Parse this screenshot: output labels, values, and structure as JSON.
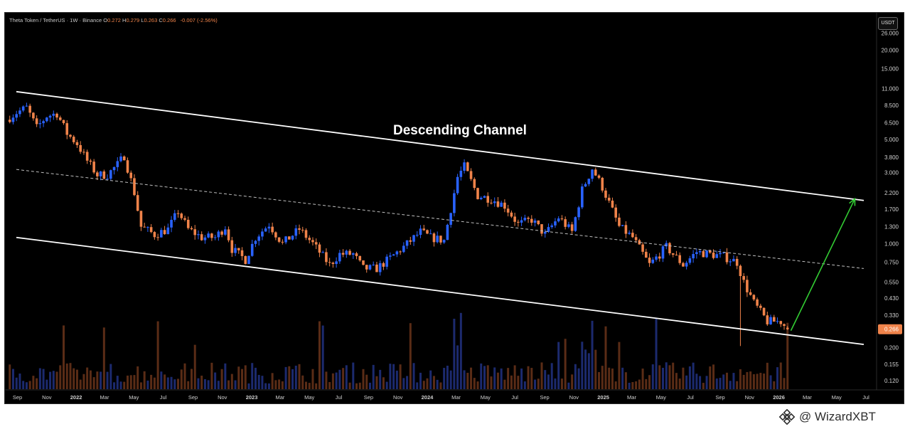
{
  "symbol_bar": {
    "title": "Theta Token / TetherUS · 1W · Binance",
    "open_label": "O",
    "open": "0.272",
    "high_label": "H",
    "high": "0.279",
    "low_label": "L",
    "low": "0.263",
    "close_label": "C",
    "close": "0.266",
    "change": "-0.007 (-2.56%)"
  },
  "currency_button": "USDT",
  "annotation": "Descending Channel",
  "watermark": {
    "icon": "binance-logo-icon",
    "text": "@ WizardXBT"
  },
  "colors": {
    "background": "#000000",
    "up": "#2962ff",
    "down": "#f0834a",
    "channel": "#ffffff",
    "arrow": "#33cc33",
    "price_tag": "#f0834a"
  },
  "chart_data": {
    "type": "candlestick",
    "scale": "log",
    "grid": false,
    "ylim": [
      0.1,
      30
    ],
    "y_ticks": [
      {
        "v": 26.0,
        "label": "26.000"
      },
      {
        "v": 20.0,
        "label": "20.000"
      },
      {
        "v": 15.0,
        "label": "15.000"
      },
      {
        "v": 11.0,
        "label": "11.000"
      },
      {
        "v": 8.5,
        "label": "8.500"
      },
      {
        "v": 6.5,
        "label": "6.500"
      },
      {
        "v": 5.0,
        "label": "5.000"
      },
      {
        "v": 3.8,
        "label": "3.800"
      },
      {
        "v": 3.0,
        "label": "3.000"
      },
      {
        "v": 2.2,
        "label": "2.200"
      },
      {
        "v": 1.7,
        "label": "1.700"
      },
      {
        "v": 1.3,
        "label": "1.300"
      },
      {
        "v": 1.0,
        "label": "1.000"
      },
      {
        "v": 0.75,
        "label": "0.750"
      },
      {
        "v": 0.55,
        "label": "0.550"
      },
      {
        "v": 0.43,
        "label": "0.430"
      },
      {
        "v": 0.33,
        "label": "0.330"
      },
      {
        "v": 0.2,
        "label": "0.200"
      },
      {
        "v": 0.155,
        "label": "0.155"
      },
      {
        "v": 0.12,
        "label": "0.120"
      }
    ],
    "current_price": {
      "value": 0.266,
      "label": "0.266"
    },
    "x_ticks": [
      {
        "date": "2021-09-01",
        "label": "Sep",
        "bold": false
      },
      {
        "date": "2021-11-01",
        "label": "Nov",
        "bold": false
      },
      {
        "date": "2022-01-01",
        "label": "2022",
        "bold": true
      },
      {
        "date": "2022-03-01",
        "label": "Mar",
        "bold": false
      },
      {
        "date": "2022-05-01",
        "label": "May",
        "bold": false
      },
      {
        "date": "2022-07-01",
        "label": "Jul",
        "bold": false
      },
      {
        "date": "2022-09-01",
        "label": "Sep",
        "bold": false
      },
      {
        "date": "2022-11-01",
        "label": "Nov",
        "bold": false
      },
      {
        "date": "2023-01-01",
        "label": "2023",
        "bold": true
      },
      {
        "date": "2023-03-01",
        "label": "Mar",
        "bold": false
      },
      {
        "date": "2023-05-01",
        "label": "May",
        "bold": false
      },
      {
        "date": "2023-07-01",
        "label": "Jul",
        "bold": false
      },
      {
        "date": "2023-09-01",
        "label": "Sep",
        "bold": false
      },
      {
        "date": "2023-11-01",
        "label": "Nov",
        "bold": false
      },
      {
        "date": "2024-01-01",
        "label": "2024",
        "bold": true
      },
      {
        "date": "2024-03-01",
        "label": "Mar",
        "bold": false
      },
      {
        "date": "2024-05-01",
        "label": "May",
        "bold": false
      },
      {
        "date": "2024-07-01",
        "label": "Jul",
        "bold": false
      },
      {
        "date": "2024-09-01",
        "label": "Sep",
        "bold": false
      },
      {
        "date": "2024-11-01",
        "label": "Nov",
        "bold": false
      },
      {
        "date": "2025-01-01",
        "label": "2025",
        "bold": true
      },
      {
        "date": "2025-03-01",
        "label": "Mar",
        "bold": false
      },
      {
        "date": "2025-05-01",
        "label": "May",
        "bold": false
      },
      {
        "date": "2025-07-01",
        "label": "Jul",
        "bold": false
      },
      {
        "date": "2025-09-01",
        "label": "Sep",
        "bold": false
      },
      {
        "date": "2025-11-01",
        "label": "Nov",
        "bold": false
      },
      {
        "date": "2026-01-01",
        "label": "2026",
        "bold": true
      },
      {
        "date": "2026-03-01",
        "label": "Mar",
        "bold": false
      },
      {
        "date": "2026-05-01",
        "label": "May",
        "bold": false
      },
      {
        "date": "2026-07-01",
        "label": "Jul",
        "bold": false
      }
    ],
    "price_path": [
      [
        "2021-08-09",
        6.8
      ],
      [
        "2021-08-30",
        7.6
      ],
      [
        "2021-09-20",
        8.2
      ],
      [
        "2021-10-11",
        6.0
      ],
      [
        "2021-11-01",
        7.2
      ],
      [
        "2021-11-22",
        7.5
      ],
      [
        "2021-12-13",
        5.5
      ],
      [
        "2022-01-03",
        4.7
      ],
      [
        "2022-01-24",
        3.6
      ],
      [
        "2022-02-14",
        2.9
      ],
      [
        "2022-03-07",
        2.9
      ],
      [
        "2022-03-28",
        3.4
      ],
      [
        "2022-04-11",
        3.9
      ],
      [
        "2022-05-02",
        2.2
      ],
      [
        "2022-05-16",
        1.3
      ],
      [
        "2022-06-13",
        1.15
      ],
      [
        "2022-07-11",
        1.25
      ],
      [
        "2022-08-01",
        1.65
      ],
      [
        "2022-08-22",
        1.25
      ],
      [
        "2022-09-19",
        1.1
      ],
      [
        "2022-10-17",
        1.1
      ],
      [
        "2022-11-07",
        1.3
      ],
      [
        "2022-11-21",
        0.92
      ],
      [
        "2022-12-19",
        0.78
      ],
      [
        "2023-01-09",
        1.1
      ],
      [
        "2023-02-06",
        1.35
      ],
      [
        "2023-03-06",
        1.0
      ],
      [
        "2023-04-10",
        1.25
      ],
      [
        "2023-05-08",
        1.0
      ],
      [
        "2023-06-12",
        0.72
      ],
      [
        "2023-07-03",
        0.85
      ],
      [
        "2023-07-31",
        0.85
      ],
      [
        "2023-08-21",
        0.68
      ],
      [
        "2023-09-18",
        0.68
      ],
      [
        "2023-10-16",
        0.8
      ],
      [
        "2023-11-13",
        0.95
      ],
      [
        "2023-12-18",
        1.2
      ],
      [
        "2024-01-08",
        1.1
      ],
      [
        "2024-02-05",
        1.05
      ],
      [
        "2024-03-04",
        2.8
      ],
      [
        "2024-03-18",
        3.3
      ],
      [
        "2024-04-15",
        2.1
      ],
      [
        "2024-05-13",
        2.0
      ],
      [
        "2024-06-10",
        1.8
      ],
      [
        "2024-07-08",
        1.35
      ],
      [
        "2024-08-05",
        1.45
      ],
      [
        "2024-09-02",
        1.15
      ],
      [
        "2024-09-30",
        1.5
      ],
      [
        "2024-10-28",
        1.2
      ],
      [
        "2024-11-18",
        2.3
      ],
      [
        "2024-12-09",
        3.2
      ],
      [
        "2024-12-30",
        2.4
      ],
      [
        "2025-02-03",
        1.3
      ],
      [
        "2025-03-03",
        1.1
      ],
      [
        "2025-04-07",
        0.72
      ],
      [
        "2025-05-12",
        0.95
      ],
      [
        "2025-06-16",
        0.72
      ],
      [
        "2025-07-14",
        0.88
      ],
      [
        "2025-08-11",
        0.85
      ],
      [
        "2025-09-08",
        0.82
      ],
      [
        "2025-10-06",
        0.75
      ],
      [
        "2025-10-20",
        0.55
      ],
      [
        "2025-11-10",
        0.4
      ],
      [
        "2025-12-08",
        0.3
      ],
      [
        "2026-01-05",
        0.3
      ],
      [
        "2026-01-19",
        0.266
      ]
    ],
    "channel": {
      "upper": [
        [
          "2021-08-09",
          10.5
        ],
        [
          "2026-07-01",
          1.95
        ]
      ],
      "middle": [
        [
          "2021-08-09",
          3.15
        ],
        [
          "2026-07-01",
          0.68
        ]
      ],
      "lower": [
        [
          "2021-08-09",
          1.1
        ],
        [
          "2026-07-01",
          0.21
        ]
      ]
    },
    "projection_arrow": [
      [
        "2026-01-26",
        0.26
      ],
      [
        "2026-06-08",
        2.0
      ]
    ],
    "volume": {
      "visible": true
    }
  }
}
